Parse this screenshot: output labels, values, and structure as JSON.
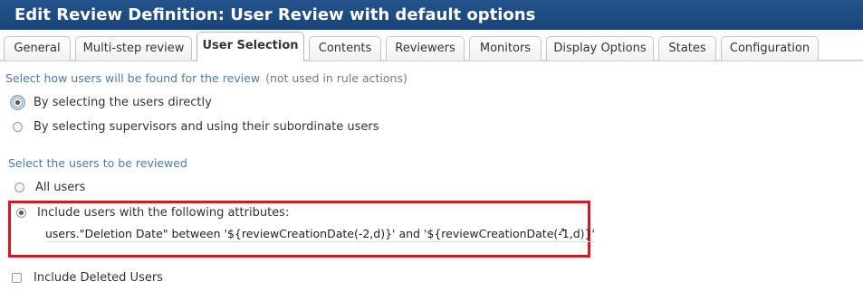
{
  "header": {
    "title": "Edit Review Definition: User Review with default options"
  },
  "tabs": [
    {
      "label": "General",
      "active": false
    },
    {
      "label": "Multi-step review",
      "active": false
    },
    {
      "label": "User Selection",
      "active": true
    },
    {
      "label": "Contents",
      "active": false
    },
    {
      "label": "Reviewers",
      "active": false
    },
    {
      "label": "Monitors",
      "active": false
    },
    {
      "label": "Display Options",
      "active": false
    },
    {
      "label": "States",
      "active": false
    },
    {
      "label": "Configuration",
      "active": false
    }
  ],
  "find_section": {
    "label": "Select how users will be found for the review",
    "note": "(not used in rule actions)",
    "options": [
      {
        "label": "By selecting the users directly",
        "checked": true
      },
      {
        "label": "By selecting supervisors and using their subordinate users",
        "checked": false
      }
    ]
  },
  "review_section": {
    "label": "Select the users to be reviewed",
    "options": [
      {
        "label": "All users",
        "checked": false
      },
      {
        "label": "Include users with the following attributes:",
        "checked": true
      }
    ],
    "expression": "users.\"Deletion Date\" between '${reviewCreationDate(-2,d)}' and '${reviewCreationDate(-1,d)}'",
    "expression_icon": "external-link-icon"
  },
  "include_deleted": {
    "label": "Include Deleted Users",
    "checked": false
  },
  "colors": {
    "header_bg": "#1a4478",
    "section_label": "#4d79aa",
    "highlight_border": "#e0141e"
  }
}
